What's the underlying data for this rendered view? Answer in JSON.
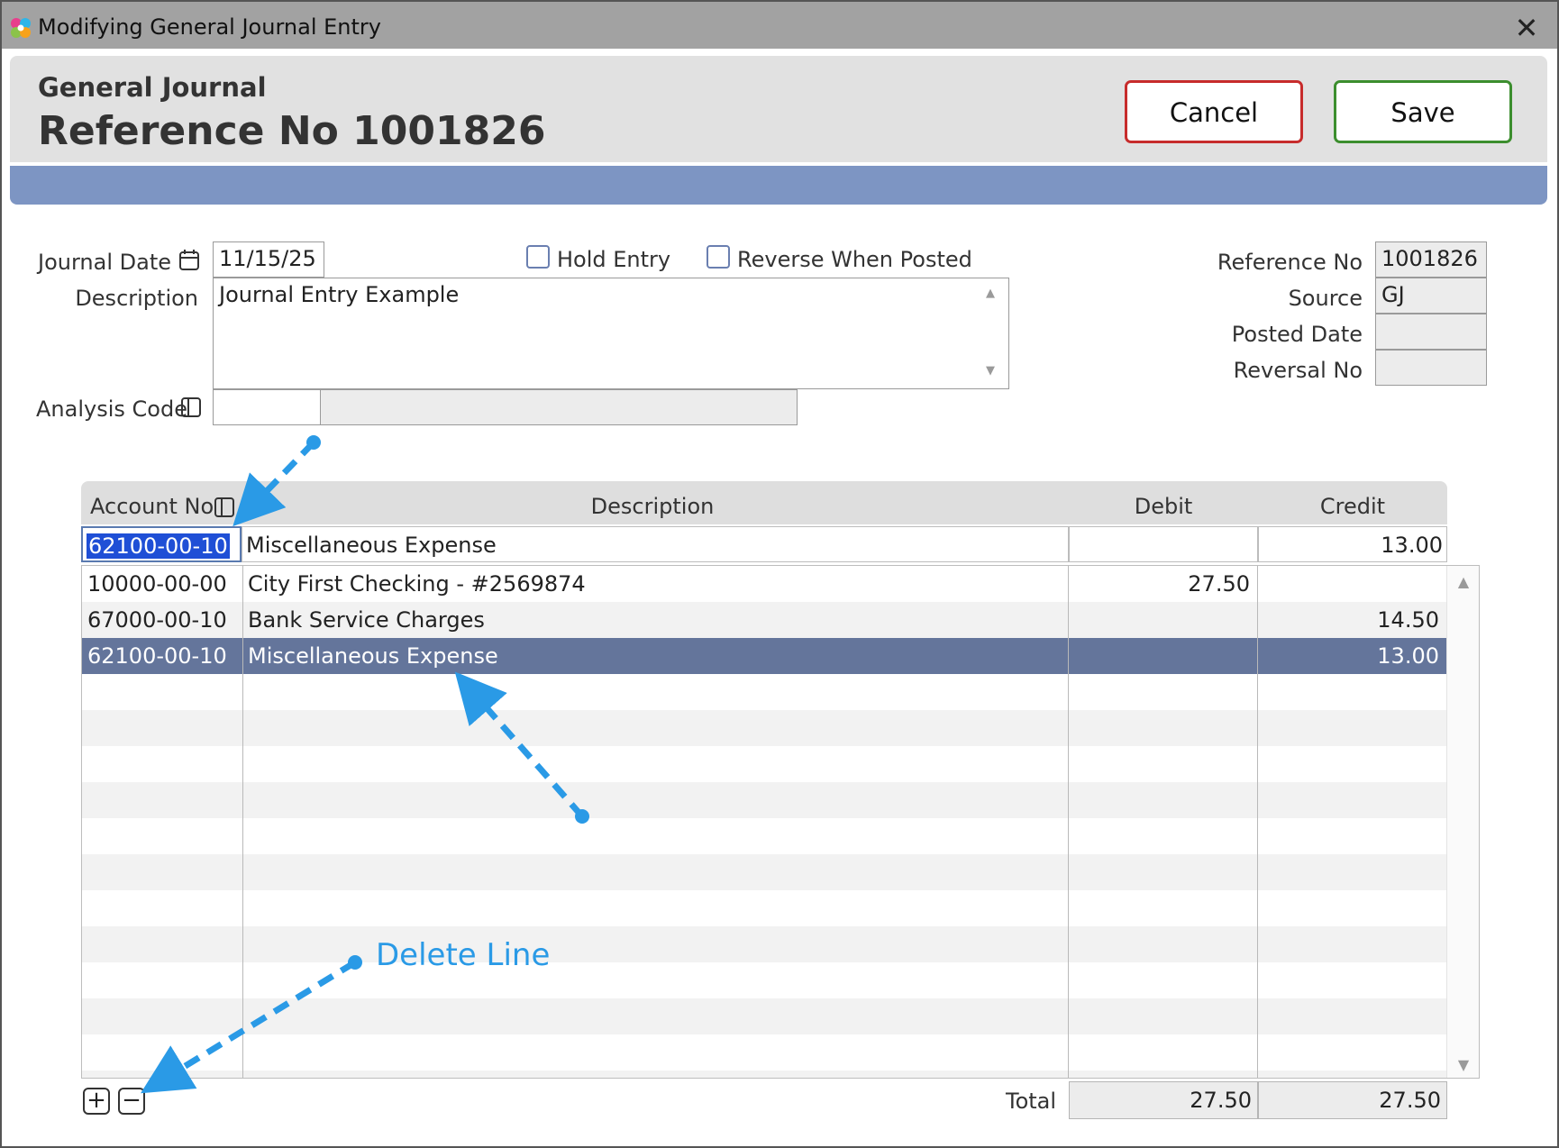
{
  "window": {
    "title": "Modifying General Journal Entry",
    "close_glyph": "✕"
  },
  "header": {
    "journal_label": "General Journal",
    "reference_title": "Reference No 1001826",
    "cancel_label": "Cancel",
    "save_label": "Save"
  },
  "form": {
    "journal_date_label": "Journal Date",
    "journal_date_value": "11/15/25",
    "hold_entry_label": "Hold Entry",
    "hold_entry_checked": false,
    "reverse_when_posted_label": "Reverse When Posted",
    "reverse_when_posted_checked": false,
    "description_label": "Description",
    "description_value": "Journal Entry Example",
    "analysis_code_label": "Analysis Code",
    "analysis_code_value": "",
    "analysis_code_desc": "",
    "reference_no_label": "Reference No",
    "reference_no_value": "1001826",
    "source_label": "Source",
    "source_value": "GJ",
    "posted_date_label": "Posted Date",
    "posted_date_value": "",
    "reversal_no_label": "Reversal No",
    "reversal_no_value": ""
  },
  "grid": {
    "columns": {
      "account_no": "Account No",
      "description": "Description",
      "debit": "Debit",
      "credit": "Credit"
    },
    "edit_row": {
      "account_no": "62100-00-10",
      "description": "Miscellaneous Expense",
      "debit": "",
      "credit": "13.00"
    },
    "rows": [
      {
        "account_no": "10000-00-00",
        "description": "City First Checking - #2569874",
        "debit": "27.50",
        "credit": ""
      },
      {
        "account_no": "67000-00-10",
        "description": "Bank Service Charges",
        "debit": "",
        "credit": "14.50"
      },
      {
        "account_no": "62100-00-10",
        "description": "Miscellaneous Expense",
        "debit": "",
        "credit": "13.00",
        "selected": true
      }
    ],
    "total_label": "Total",
    "total_debit": "27.50",
    "total_credit": "27.50"
  },
  "annotation": {
    "delete_line_label": "Delete Line",
    "color": "#2a9ae6"
  },
  "colors": {
    "titlebar": "#a2a2a2",
    "header": "#e1e1e1",
    "band": "#7d95c3",
    "cancel_border": "#c72c2c",
    "save_border": "#3c8e2e",
    "selected_row": "#64759b",
    "selection_highlight": "#1f4fd6"
  },
  "icons": {
    "app_logo": "colorful-flower-icon",
    "calendar": "calendar-icon",
    "lookup": "lookup-panel-icon",
    "add_line": "plus-square-icon",
    "delete_line": "minus-square-icon"
  }
}
